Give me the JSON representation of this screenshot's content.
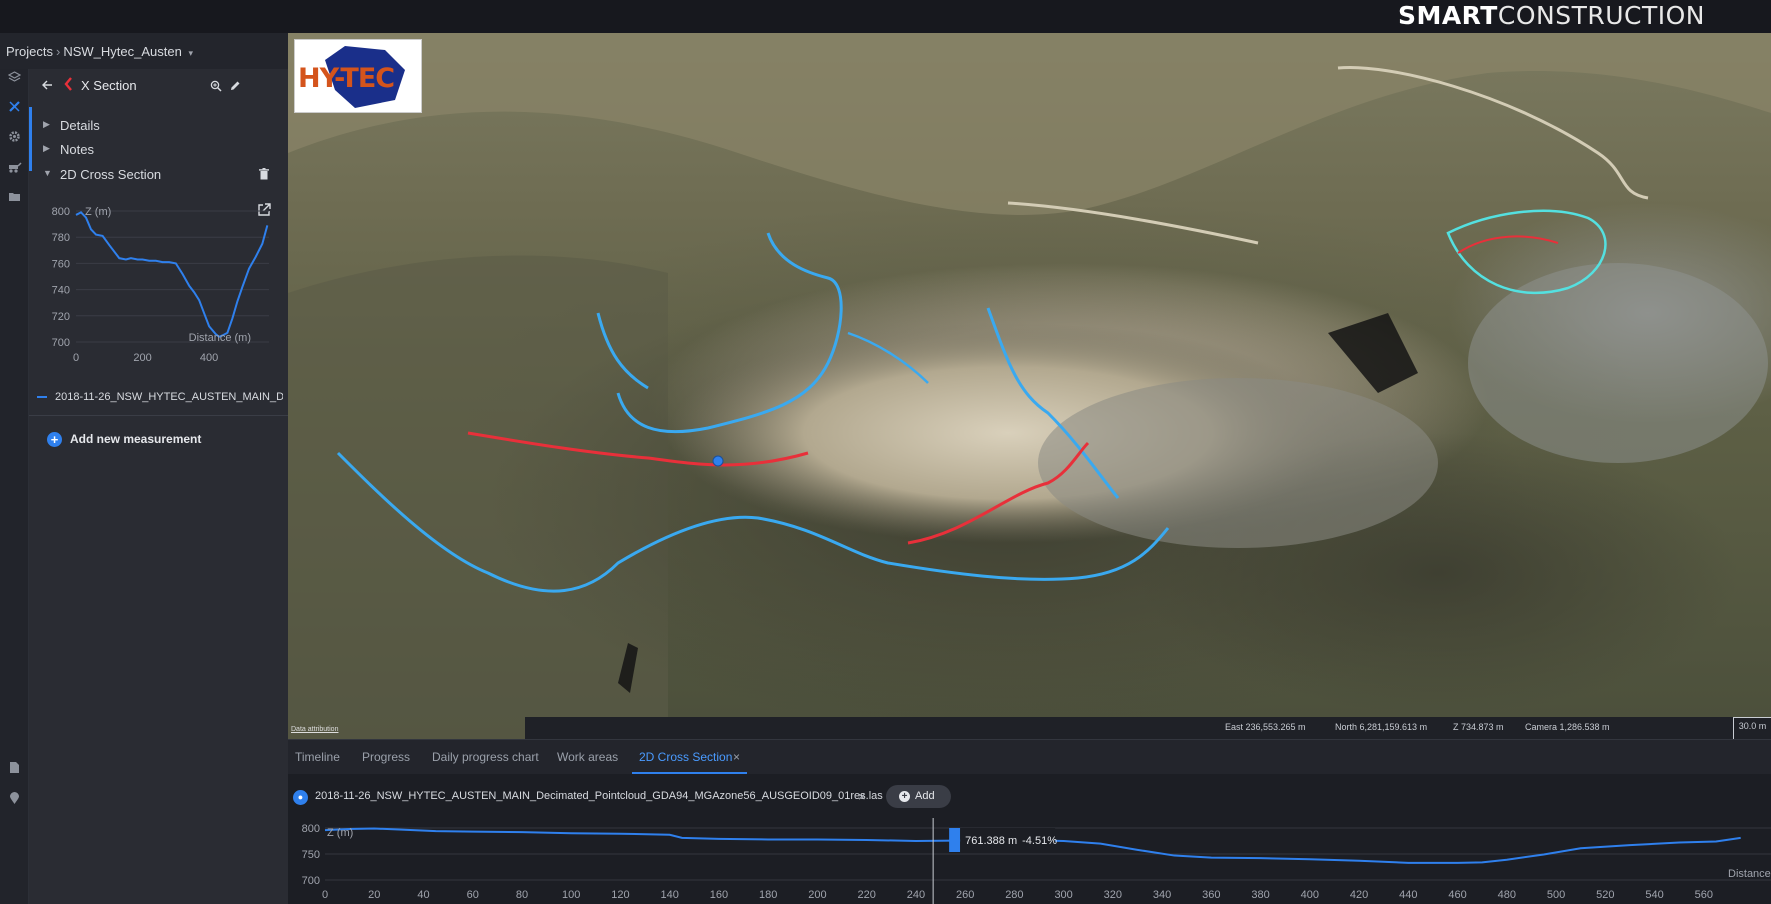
{
  "brand": {
    "bold": "SMART",
    "thin": "CONSTRUCTION"
  },
  "breadcrumb": {
    "root": "Projects",
    "project": "NSW_Hytec_Austen"
  },
  "panel": {
    "title": "X Section",
    "sections": [
      {
        "label": "Details",
        "expanded": false
      },
      {
        "label": "Notes",
        "expanded": false
      },
      {
        "label": "2D Cross Section",
        "expanded": true
      }
    ],
    "legend_entry": "2018-11-26_NSW_HYTEC_AUSTEN_MAIN_D...",
    "add_measurement": "Add new measurement"
  },
  "viewport": {
    "logo_text": "HY-TEC",
    "attribution": "Data attribution",
    "east": "East 236,553.265 m",
    "north": "North 6,281,159.613 m",
    "z": "Z 734.873 m",
    "camera": "Camera 1,286.538 m",
    "scale": "30.0 m"
  },
  "tabs": [
    {
      "label": "Timeline",
      "active": false
    },
    {
      "label": "Progress",
      "active": false
    },
    {
      "label": "Daily progress chart",
      "active": false
    },
    {
      "label": "Work areas",
      "active": false
    },
    {
      "label": "2D Cross Section",
      "active": true
    }
  ],
  "file": {
    "name": "2018-11-26_NSW_HYTEC_AUSTEN_MAIN_Decimated_Pointcloud_GDA94_MGAzone56_AUSGEOID09_01res.las",
    "add_label": "Add"
  },
  "cursor_readout": {
    "value": "761.388 m",
    "slope": "-4.51%",
    "at_distance": 247
  },
  "icons": {
    "back": "arrow-left-icon",
    "zoom": "zoom-icon",
    "edit": "pencil-icon",
    "delete": "trash-icon",
    "popout": "external-link-icon"
  },
  "colors": {
    "accent": "#2f80ed",
    "profile_line": "#2f80ed",
    "overlay_blue": "#3aa9f0",
    "overlay_red": "#e8303a"
  },
  "chart_data": [
    {
      "type": "line",
      "title": "",
      "xlabel": "Distance (m)",
      "ylabel": "Z (m)",
      "xlim": [
        0,
        580
      ],
      "ylim": [
        700,
        800
      ],
      "xticks": [
        0,
        200,
        400
      ],
      "yticks": [
        700,
        720,
        740,
        760,
        780,
        800
      ],
      "grid": true,
      "series": [
        {
          "name": "2018-11-26_NSW_HYTEC_AUSTEN_MAIN_D...",
          "x": [
            0,
            15,
            30,
            45,
            60,
            80,
            100,
            130,
            150,
            165,
            185,
            200,
            220,
            240,
            260,
            280,
            300,
            320,
            340,
            355,
            370,
            385,
            400,
            420,
            430,
            440,
            455,
            470,
            485,
            500,
            520,
            540,
            560,
            575
          ],
          "values": [
            797,
            799,
            795,
            786,
            782,
            781,
            774,
            764,
            763,
            764,
            763,
            763,
            762,
            762,
            761,
            761,
            760,
            752,
            743,
            738,
            732,
            722,
            712,
            706,
            704,
            705,
            707,
            718,
            731,
            742,
            756,
            765,
            775,
            789
          ]
        }
      ]
    },
    {
      "type": "line",
      "title": "",
      "xlabel": "Distance (m)",
      "ylabel": "Z (m)",
      "xlim": [
        0,
        580
      ],
      "ylim": [
        700,
        800
      ],
      "xticks": [
        0,
        20,
        40,
        60,
        80,
        100,
        120,
        140,
        160,
        180,
        200,
        220,
        240,
        260,
        280,
        300,
        320,
        340,
        360,
        380,
        400,
        420,
        440,
        460,
        480,
        500,
        520,
        540,
        560
      ],
      "yticks": [
        700,
        750,
        800
      ],
      "grid": true,
      "series": [
        {
          "name": "2018-11-26_NSW_HYTEC_AUSTEN_MAIN_Decimated_Pointcloud_GDA94_MGAzone56_AUSGEOID09_01res.las",
          "x": [
            0,
            10,
            20,
            30,
            45,
            60,
            80,
            100,
            120,
            140,
            145,
            160,
            180,
            200,
            220,
            240,
            260,
            280,
            300,
            315,
            330,
            345,
            360,
            380,
            400,
            420,
            440,
            460,
            470,
            480,
            495,
            510,
            530,
            550,
            565,
            575
          ],
          "values": [
            796,
            798,
            799,
            797,
            794,
            793,
            792,
            790,
            789,
            787,
            781,
            779,
            778,
            778,
            777,
            775,
            776,
            777,
            775,
            770,
            758,
            747,
            743,
            742,
            740,
            737,
            733,
            733,
            734,
            739,
            749,
            761,
            767,
            772,
            774,
            781
          ]
        }
      ]
    }
  ]
}
